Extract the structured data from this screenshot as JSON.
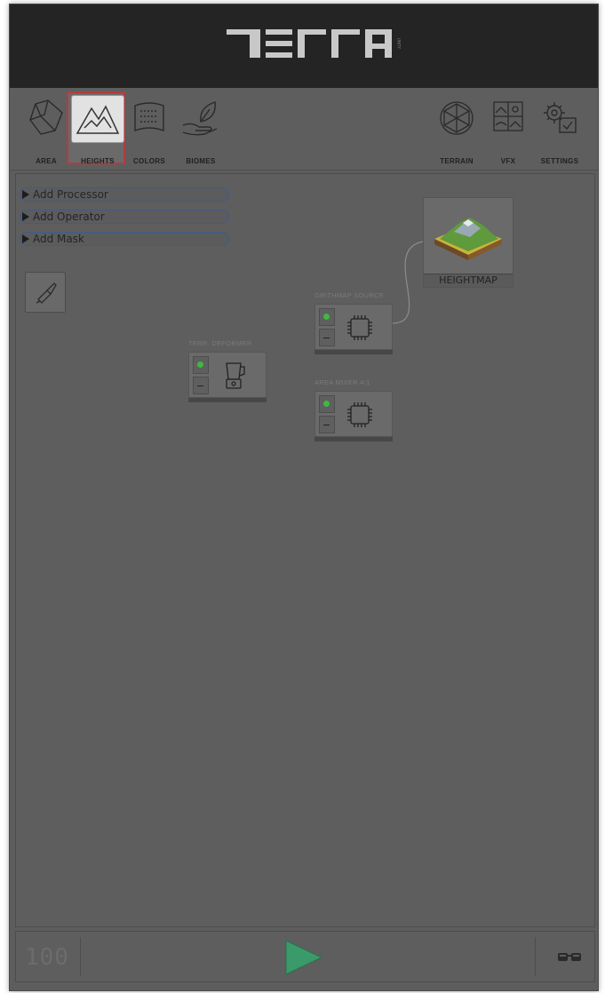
{
  "app": {
    "logo_text": "TERRA",
    "logo_sub": "UNITY"
  },
  "toolbar": {
    "items": [
      {
        "label": "AREA",
        "icon": "area-map-icon",
        "selected": false
      },
      {
        "label": "HEIGHTS",
        "icon": "mountain-icon",
        "selected": true
      },
      {
        "label": "COLORS",
        "icon": "texture-icon",
        "selected": false
      },
      {
        "label": "BIOMES",
        "icon": "leaf-hand-icon",
        "selected": false
      },
      {
        "label": "TERRAIN",
        "icon": "sphere-icon",
        "selected": false
      },
      {
        "label": "VFX",
        "icon": "landscape-icon",
        "selected": false
      },
      {
        "label": "SETTINGS",
        "icon": "gear-icon",
        "selected": false
      }
    ]
  },
  "graph": {
    "add_buttons": [
      "Add Processor",
      "Add Operator",
      "Add Mask"
    ],
    "nodes": [
      {
        "title": "GRITHMAP SOURCE",
        "icon": "chip-icon"
      },
      {
        "title": "AREA MIXER 4:1",
        "icon": "chip-icon"
      },
      {
        "title": "TERR. DEFORMER",
        "icon": "blender-icon"
      }
    ],
    "output": {
      "label": "HEIGHTMAP"
    }
  },
  "bottombar": {
    "counter": "100"
  },
  "colors": {
    "selected_border": "#b33c3c",
    "led": "#3fb83f",
    "play": "#3a9a6a",
    "add_border": "#3e5b8f"
  }
}
